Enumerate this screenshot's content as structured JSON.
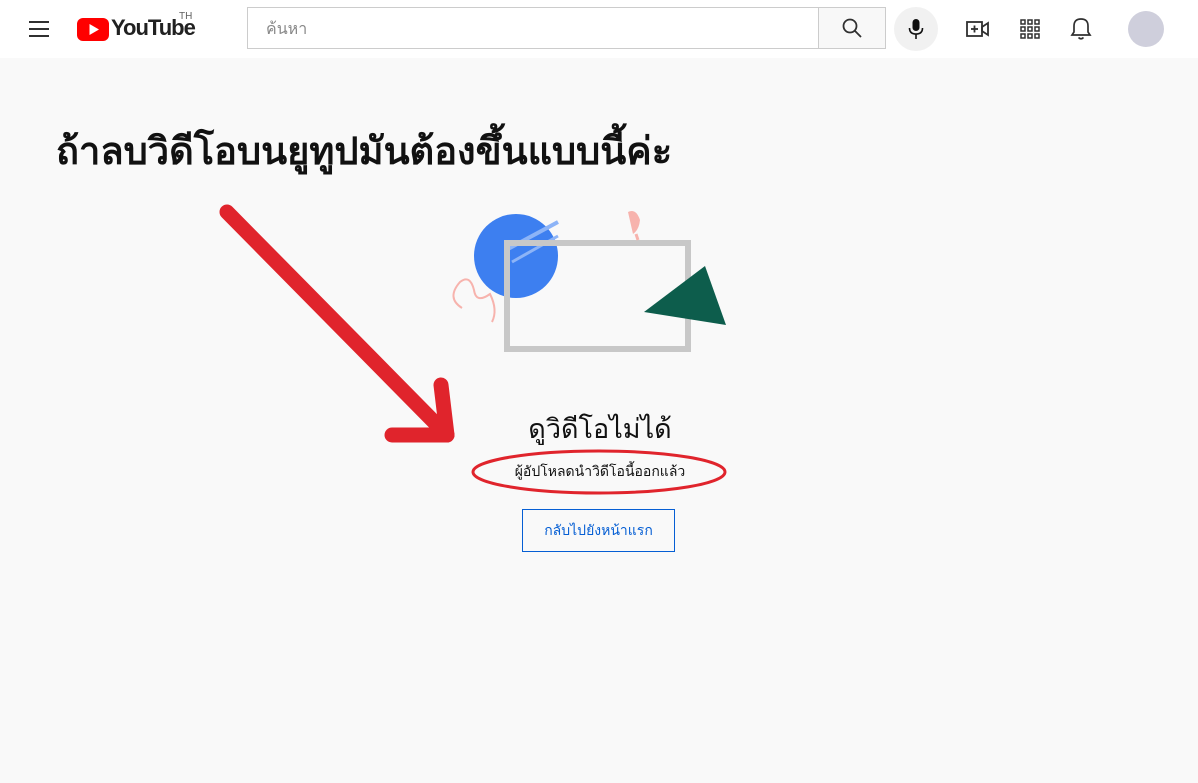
{
  "header": {
    "logo_text": "YouTube",
    "logo_region": "TH",
    "search_placeholder": "ค้นหา",
    "icons": [
      "menu-icon",
      "search-icon",
      "microphone-icon",
      "create-video-icon",
      "apps-grid-icon",
      "bell-icon"
    ],
    "brand_color": "#ff0000"
  },
  "annotation": {
    "caption": "ถ้าลบวิดีโอบนยูทูปมันต้องขึ้นแบบนี้ค่ะ",
    "color": "#e0242c"
  },
  "error": {
    "title": "ดูวิดีโอไม่ได้",
    "message": "ผู้อัปโหลดนำวิดีโอนี้ออกแล้ว",
    "button_label": "กลับไปยังหน้าแรก"
  }
}
